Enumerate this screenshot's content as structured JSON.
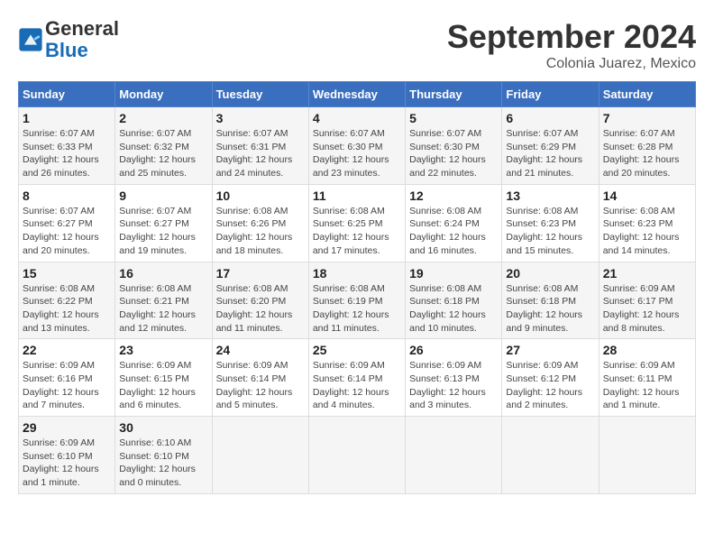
{
  "logo": {
    "general": "General",
    "blue": "Blue"
  },
  "title": "September 2024",
  "subtitle": "Colonia Juarez, Mexico",
  "days_header": [
    "Sunday",
    "Monday",
    "Tuesday",
    "Wednesday",
    "Thursday",
    "Friday",
    "Saturday"
  ],
  "weeks": [
    [
      {
        "day": "1",
        "info": "Sunrise: 6:07 AM\nSunset: 6:33 PM\nDaylight: 12 hours\nand 26 minutes."
      },
      {
        "day": "2",
        "info": "Sunrise: 6:07 AM\nSunset: 6:32 PM\nDaylight: 12 hours\nand 25 minutes."
      },
      {
        "day": "3",
        "info": "Sunrise: 6:07 AM\nSunset: 6:31 PM\nDaylight: 12 hours\nand 24 minutes."
      },
      {
        "day": "4",
        "info": "Sunrise: 6:07 AM\nSunset: 6:30 PM\nDaylight: 12 hours\nand 23 minutes."
      },
      {
        "day": "5",
        "info": "Sunrise: 6:07 AM\nSunset: 6:30 PM\nDaylight: 12 hours\nand 22 minutes."
      },
      {
        "day": "6",
        "info": "Sunrise: 6:07 AM\nSunset: 6:29 PM\nDaylight: 12 hours\nand 21 minutes."
      },
      {
        "day": "7",
        "info": "Sunrise: 6:07 AM\nSunset: 6:28 PM\nDaylight: 12 hours\nand 20 minutes."
      }
    ],
    [
      {
        "day": "8",
        "info": "Sunrise: 6:07 AM\nSunset: 6:27 PM\nDaylight: 12 hours\nand 20 minutes."
      },
      {
        "day": "9",
        "info": "Sunrise: 6:07 AM\nSunset: 6:27 PM\nDaylight: 12 hours\nand 19 minutes."
      },
      {
        "day": "10",
        "info": "Sunrise: 6:08 AM\nSunset: 6:26 PM\nDaylight: 12 hours\nand 18 minutes."
      },
      {
        "day": "11",
        "info": "Sunrise: 6:08 AM\nSunset: 6:25 PM\nDaylight: 12 hours\nand 17 minutes."
      },
      {
        "day": "12",
        "info": "Sunrise: 6:08 AM\nSunset: 6:24 PM\nDaylight: 12 hours\nand 16 minutes."
      },
      {
        "day": "13",
        "info": "Sunrise: 6:08 AM\nSunset: 6:23 PM\nDaylight: 12 hours\nand 15 minutes."
      },
      {
        "day": "14",
        "info": "Sunrise: 6:08 AM\nSunset: 6:23 PM\nDaylight: 12 hours\nand 14 minutes."
      }
    ],
    [
      {
        "day": "15",
        "info": "Sunrise: 6:08 AM\nSunset: 6:22 PM\nDaylight: 12 hours\nand 13 minutes."
      },
      {
        "day": "16",
        "info": "Sunrise: 6:08 AM\nSunset: 6:21 PM\nDaylight: 12 hours\nand 12 minutes."
      },
      {
        "day": "17",
        "info": "Sunrise: 6:08 AM\nSunset: 6:20 PM\nDaylight: 12 hours\nand 11 minutes."
      },
      {
        "day": "18",
        "info": "Sunrise: 6:08 AM\nSunset: 6:19 PM\nDaylight: 12 hours\nand 11 minutes."
      },
      {
        "day": "19",
        "info": "Sunrise: 6:08 AM\nSunset: 6:18 PM\nDaylight: 12 hours\nand 10 minutes."
      },
      {
        "day": "20",
        "info": "Sunrise: 6:08 AM\nSunset: 6:18 PM\nDaylight: 12 hours\nand 9 minutes."
      },
      {
        "day": "21",
        "info": "Sunrise: 6:09 AM\nSunset: 6:17 PM\nDaylight: 12 hours\nand 8 minutes."
      }
    ],
    [
      {
        "day": "22",
        "info": "Sunrise: 6:09 AM\nSunset: 6:16 PM\nDaylight: 12 hours\nand 7 minutes."
      },
      {
        "day": "23",
        "info": "Sunrise: 6:09 AM\nSunset: 6:15 PM\nDaylight: 12 hours\nand 6 minutes."
      },
      {
        "day": "24",
        "info": "Sunrise: 6:09 AM\nSunset: 6:14 PM\nDaylight: 12 hours\nand 5 minutes."
      },
      {
        "day": "25",
        "info": "Sunrise: 6:09 AM\nSunset: 6:14 PM\nDaylight: 12 hours\nand 4 minutes."
      },
      {
        "day": "26",
        "info": "Sunrise: 6:09 AM\nSunset: 6:13 PM\nDaylight: 12 hours\nand 3 minutes."
      },
      {
        "day": "27",
        "info": "Sunrise: 6:09 AM\nSunset: 6:12 PM\nDaylight: 12 hours\nand 2 minutes."
      },
      {
        "day": "28",
        "info": "Sunrise: 6:09 AM\nSunset: 6:11 PM\nDaylight: 12 hours\nand 1 minute."
      }
    ],
    [
      {
        "day": "29",
        "info": "Sunrise: 6:09 AM\nSunset: 6:10 PM\nDaylight: 12 hours\nand 1 minute."
      },
      {
        "day": "30",
        "info": "Sunrise: 6:10 AM\nSunset: 6:10 PM\nDaylight: 12 hours\nand 0 minutes."
      },
      {
        "day": "",
        "info": ""
      },
      {
        "day": "",
        "info": ""
      },
      {
        "day": "",
        "info": ""
      },
      {
        "day": "",
        "info": ""
      },
      {
        "day": "",
        "info": ""
      }
    ]
  ]
}
